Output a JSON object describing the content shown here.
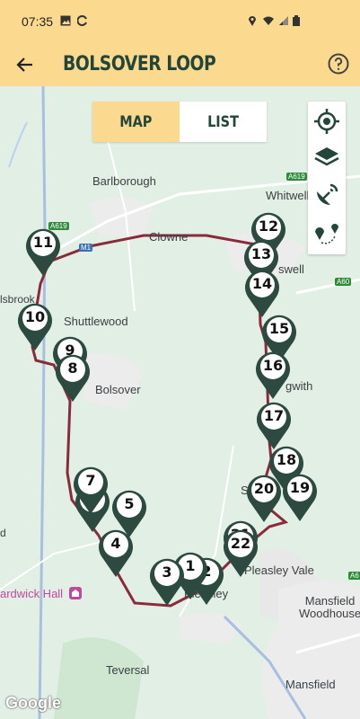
{
  "status": {
    "time": "07:35"
  },
  "header": {
    "title": "BOLSOVER LOOP"
  },
  "toggle": {
    "map_label": "MAP",
    "list_label": "LIST"
  },
  "places": {
    "barlborough": "Barlborough",
    "clowne": "Clowne",
    "whitwell": "Whitwell",
    "creswell": "swell",
    "shuttlewood": "Shuttlewood",
    "bolsover": "Bolsover",
    "langwith": "gwith",
    "shirebrook": "S",
    "pleasley_vale": "Pleasley Vale",
    "pleasley": "Pleasley",
    "hardwick_hall": "ardwick Hall",
    "mansfield_woodhouse": "Mansfield\nWoodhouse",
    "teversal": "Teversal",
    "mansfield": "Mansfield",
    "lsbrook": "lsbrook",
    "d_edge": "d"
  },
  "roads": {
    "a619_top": "A619",
    "a619_left": "A619",
    "m1": "M1",
    "a60": "A60",
    "a6": "A6"
  },
  "markers": [
    "1",
    "2",
    "3",
    "4",
    "5",
    "6",
    "7",
    "8",
    "9",
    "10",
    "11",
    "12",
    "13",
    "14",
    "15",
    "16",
    "17",
    "18",
    "19",
    "20",
    "21",
    "22"
  ],
  "attribution": "Google",
  "colors": {
    "header_bg": "#fbd98f",
    "brand": "#22463a",
    "route": "#8a2b3c",
    "marker": "#2c4a40"
  }
}
